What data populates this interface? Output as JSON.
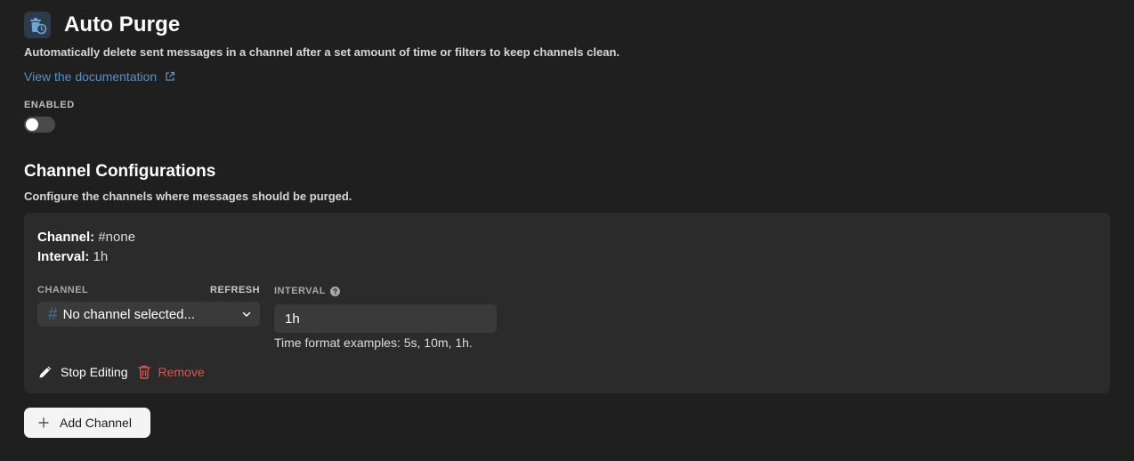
{
  "header": {
    "title": "Auto Purge",
    "description": "Automatically delete sent messages in a channel after a set amount of time or filters to keep channels clean.",
    "doc_link": "View the documentation"
  },
  "enabled": {
    "label": "ENABLED",
    "value": false
  },
  "section": {
    "title": "Channel Configurations",
    "description": "Configure the channels where messages should be purged."
  },
  "config": {
    "summary_channel_label": "Channel:",
    "summary_channel_value": "#none",
    "summary_interval_label": "Interval:",
    "summary_interval_value": "1h",
    "channel_field_label": "CHANNEL",
    "refresh_label": "REFRESH",
    "interval_field_label": "INTERVAL",
    "channel_hash": "#",
    "channel_select_value": "No channel selected...",
    "interval_value": "1h",
    "interval_hint": "Time format examples: 5s, 10m, 1h.",
    "stop_editing_label": "Stop Editing",
    "remove_label": "Remove"
  },
  "add_channel_label": "Add Channel",
  "colors": {
    "background": "#1f1f1f",
    "card": "#2b2b2b",
    "link": "#5a8fc4",
    "danger": "#d9574a",
    "button_light": "#f4f4f4"
  }
}
